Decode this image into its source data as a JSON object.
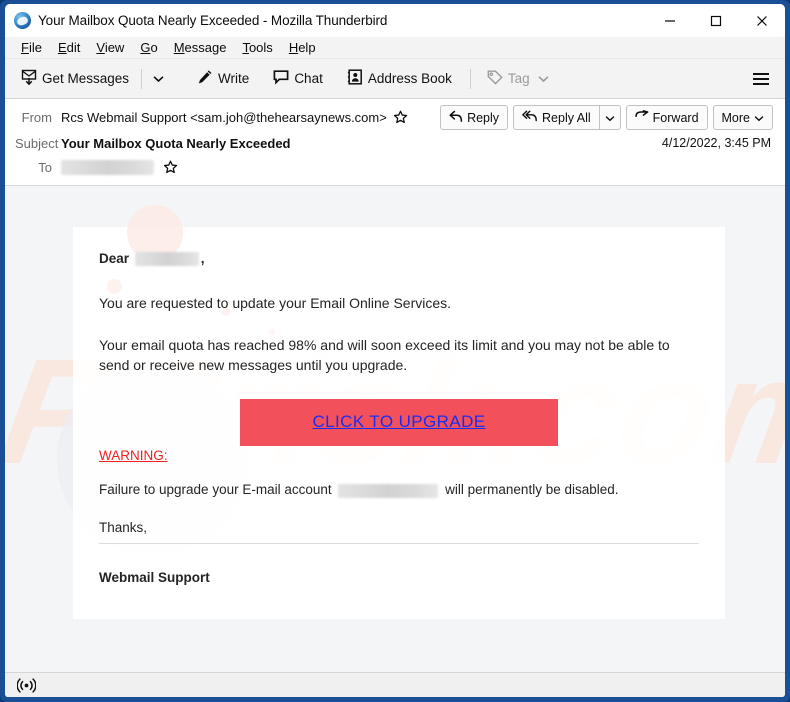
{
  "window": {
    "title": "Your Mailbox Quota Nearly Exceeded - Mozilla Thunderbird",
    "app_icon": "thunderbird-icon",
    "border_color": "#1a4f96",
    "controls": {
      "minimize": "minimize-icon",
      "maximize": "maximize-icon",
      "close": "close-icon"
    }
  },
  "menubar": {
    "items": [
      {
        "label": "File",
        "accesskey": "F"
      },
      {
        "label": "Edit",
        "accesskey": "E"
      },
      {
        "label": "View",
        "accesskey": "V"
      },
      {
        "label": "Go",
        "accesskey": "G"
      },
      {
        "label": "Message",
        "accesskey": "M"
      },
      {
        "label": "Tools",
        "accesskey": "T"
      },
      {
        "label": "Help",
        "accesskey": "H"
      }
    ]
  },
  "toolbar": {
    "get_messages": "Get Messages",
    "get_messages_icon": "download-mail-icon",
    "get_messages_caret": "chevron-down-icon",
    "write": "Write",
    "write_icon": "pencil-icon",
    "chat": "Chat",
    "chat_icon": "speech-bubble-icon",
    "address_book": "Address Book",
    "address_book_icon": "contact-card-icon",
    "tag": "Tag",
    "tag_icon": "tag-icon",
    "tag_caret": "chevron-down-icon",
    "tag_disabled": true,
    "app_menu_icon": "hamburger-menu-icon"
  },
  "message_header": {
    "from_label": "From",
    "from_value": "Rcs Webmail Support <sam.joh@thehearsaynews.com>",
    "subject_label": "Subject",
    "subject_value": "Your Mailbox Quota Nearly Exceeded",
    "to_label": "To",
    "to_value_redacted": true,
    "date": "4/12/2022, 3:45 PM",
    "star_icon": "star-outline-icon",
    "actions": {
      "reply": "Reply",
      "reply_icon": "reply-arrow-icon",
      "reply_all": "Reply All",
      "reply_all_icon": "reply-all-arrow-icon",
      "reply_all_caret": "chevron-down-icon",
      "forward": "Forward",
      "forward_icon": "forward-arrow-icon",
      "more": "More",
      "more_caret": "chevron-down-icon"
    }
  },
  "mail_body": {
    "watermark_text": "PCrisk.com",
    "greeting_prefix": "Dear",
    "greeting_redacted": true,
    "greeting_suffix": ",",
    "paragraph_1": "You are requested to update your Email Online Services.",
    "paragraph_2": "Your email quota has reached 98% and will soon exceed its limit and you may not be able to send or receive new messages until you upgrade.",
    "cta_label": "CLICK TO UPGRADE",
    "cta_bg_color": "#f2505a",
    "cta_link_color": "#1a2ef0",
    "warning_label": "WARNING:",
    "warning_color": "#ef2020",
    "failure_prefix": "Failure to upgrade your E-mail account",
    "failure_redacted": true,
    "failure_suffix": "will permanently be disabled.",
    "thanks": "Thanks,",
    "signature": "Webmail Support"
  },
  "statusbar": {
    "connection_icon": "broadcast-online-icon",
    "text": ""
  }
}
